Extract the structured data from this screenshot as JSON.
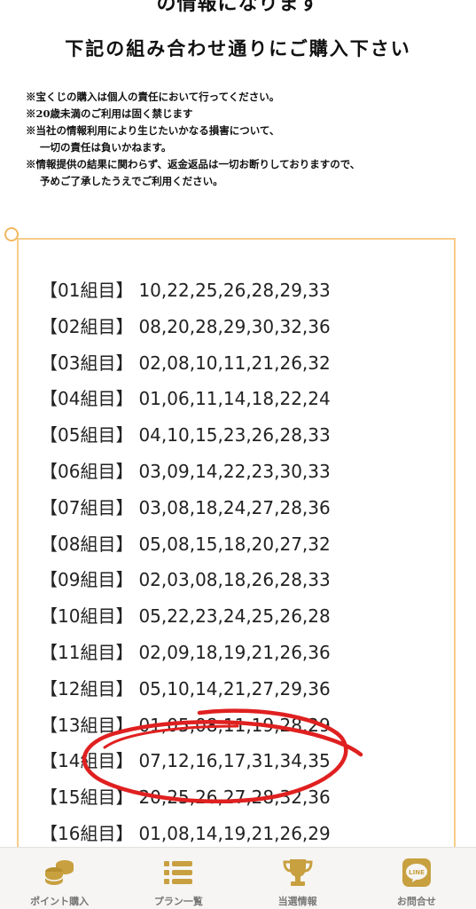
{
  "header": {
    "line1": "の情報になります",
    "line2": "下記の組み合わせ通りにご購入下さい"
  },
  "notes": [
    "※宝くじの購入は個人の責任において行ってください。",
    "※20歳未満のご利用は固く禁じます",
    "※当社の情報利用により生じたいかなる損害について、",
    "一切の責任は負いかねます。",
    "※情報提供の結果に関わらず、返金返品は一切お断りしておりますので、",
    "予めご了承したうえでご利用ください。"
  ],
  "combos": [
    {
      "label": "【01組目】",
      "numbers": "10,22,25,26,28,29,33"
    },
    {
      "label": "【02組目】",
      "numbers": "08,20,28,29,30,32,36"
    },
    {
      "label": "【03組目】",
      "numbers": "02,08,10,11,21,26,32"
    },
    {
      "label": "【04組目】",
      "numbers": "01,06,11,14,18,22,24"
    },
    {
      "label": "【05組目】",
      "numbers": "04,10,15,23,26,28,33"
    },
    {
      "label": "【06組目】",
      "numbers": "03,09,14,22,23,30,33"
    },
    {
      "label": "【07組目】",
      "numbers": "03,08,18,24,27,28,36"
    },
    {
      "label": "【08組目】",
      "numbers": "05,08,15,18,20,27,32"
    },
    {
      "label": "【09組目】",
      "numbers": "02,03,08,18,26,28,33"
    },
    {
      "label": "【10組目】",
      "numbers": "05,22,23,24,25,26,28"
    },
    {
      "label": "【11組目】",
      "numbers": "02,09,18,19,21,26,36"
    },
    {
      "label": "【12組目】",
      "numbers": "05,10,14,21,27,29,36"
    },
    {
      "label": "【13組目】",
      "numbers": "01,05,08,11,19,28,29"
    },
    {
      "label": "【14組目】",
      "numbers": "07,12,16,17,31,34,35"
    },
    {
      "label": "【15組目】",
      "numbers": "20,25,26,27,28,32,36"
    },
    {
      "label": "【16組目】",
      "numbers": "01,08,14,19,21,26,29"
    }
  ],
  "nav": {
    "items": [
      {
        "label": "ポイント購入",
        "icon": "coins-icon"
      },
      {
        "label": "プラン一覧",
        "icon": "list-icon"
      },
      {
        "label": "当選情報",
        "icon": "trophy-icon"
      },
      {
        "label": "お問合せ",
        "icon": "line-chat-icon"
      }
    ],
    "icon_color": "#c8a040",
    "line_icon_text": "LINE"
  },
  "colors": {
    "card_border": "#f7cd8a",
    "annotation_red": "#e02020"
  }
}
